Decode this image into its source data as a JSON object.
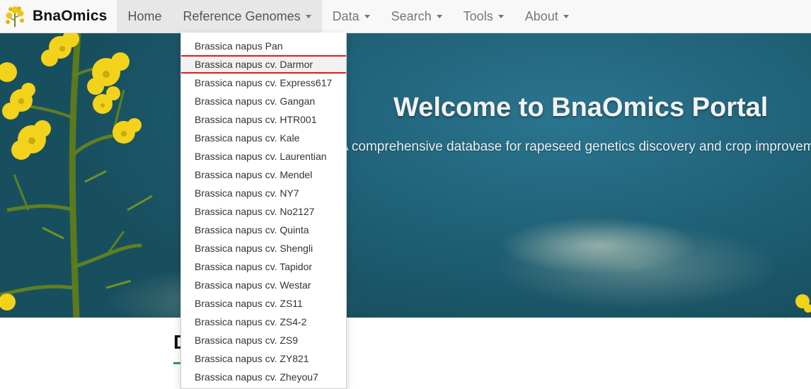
{
  "navbar": {
    "brand": "BnaOmics",
    "items": [
      {
        "label": "Home"
      },
      {
        "label": "Reference Genomes"
      },
      {
        "label": "Data"
      },
      {
        "label": "Search"
      },
      {
        "label": "Tools"
      },
      {
        "label": "About"
      }
    ]
  },
  "dropdown": {
    "items": [
      "Brassica napus Pan",
      "Brassica napus cv. Darmor",
      "Brassica napus cv. Express617",
      "Brassica napus cv. Gangan",
      "Brassica napus cv. HTR001",
      "Brassica napus cv. Kale",
      "Brassica napus cv. Laurentian",
      "Brassica napus cv. Mendel",
      "Brassica napus cv. NY7",
      "Brassica napus cv. No2127",
      "Brassica napus cv. Quinta",
      "Brassica napus cv. Shengli",
      "Brassica napus cv. Tapidor",
      "Brassica napus cv. Westar",
      "Brassica napus cv. ZS11",
      "Brassica napus cv. ZS4-2",
      "Brassica napus cv. ZS9",
      "Brassica napus cv. ZY821",
      "Brassica napus cv. Zheyou7"
    ]
  },
  "hero": {
    "title": "Welcome to BnaOmics Portal",
    "subtitle": "A comprehensive database for rapeseed genetics discovery and crop improveme"
  },
  "section": {
    "heading": "D"
  },
  "colors": {
    "highlight_border": "#e21b1b",
    "underline": "#2aa24a",
    "flower": "#f2d21a",
    "sky": "#1f6075"
  }
}
